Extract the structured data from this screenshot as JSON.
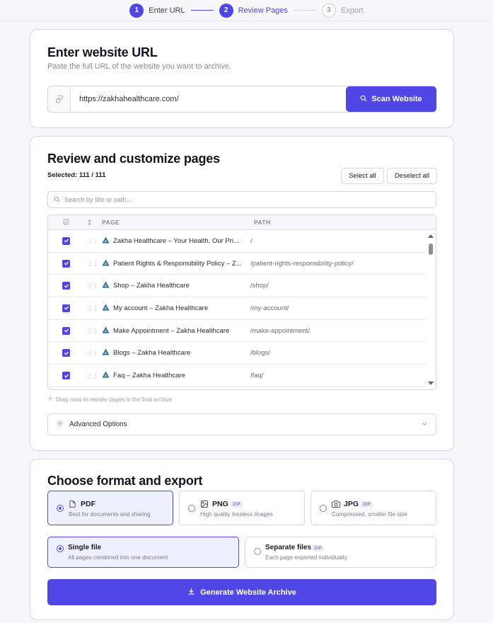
{
  "stepper": {
    "steps": [
      {
        "num": "1",
        "label": "Enter URL"
      },
      {
        "num": "2",
        "label": "Review Pages"
      },
      {
        "num": "3",
        "label": "Export"
      }
    ]
  },
  "url_section": {
    "title": "Enter website URL",
    "subtitle": "Paste the full URL of the website you want to archive.",
    "url_value": "https://zakhahealthcare.com/",
    "scan_label": "Scan Website"
  },
  "review": {
    "title": "Review and customize pages",
    "selected_label": "Selected: 111 / 111",
    "select_all": "Select all",
    "deselect_all": "Deselect all",
    "search_placeholder": "Search by title or path...",
    "col_page": "PAGE",
    "col_path": "PATH",
    "rows": [
      {
        "title": "Zakha Healthcare – Your Health, Our Pri...",
        "path": "/"
      },
      {
        "title": "Patient Rights & Responsibility Policy – Z...",
        "path": "/patient-rights-responsibility-policy/"
      },
      {
        "title": "Shop – Zakha Healthcare",
        "path": "/shop/"
      },
      {
        "title": "My account – Zakha Healthcare",
        "path": "/my-account/"
      },
      {
        "title": "Make Appointment – Zakha Healthcare",
        "path": "/make-appointment/"
      },
      {
        "title": "Blogs – Zakha Healthcare",
        "path": "/blogs/"
      },
      {
        "title": "Faq – Zakha Healthcare",
        "path": "/faq/"
      }
    ],
    "drag_hint": "Drag rows to reorder pages in the final archive",
    "advanced": "Advanced Options"
  },
  "export": {
    "title": "Choose format and export",
    "formats": [
      {
        "name": "PDF",
        "desc": "Best for documents and sharing",
        "zip": ""
      },
      {
        "name": "PNG",
        "desc": "High quality lossless images",
        "zip": "ZIP"
      },
      {
        "name": "JPG",
        "desc": "Compressed, smaller file size",
        "zip": "ZIP"
      }
    ],
    "modes": [
      {
        "name": "Single file",
        "desc": "All pages combined into one document",
        "zip": ""
      },
      {
        "name": "Separate files",
        "desc": "Each page exported individually",
        "zip": "ZIP"
      }
    ],
    "generate_label": "Generate Website Archive"
  },
  "colors": {
    "accent": "#4f46e5"
  }
}
